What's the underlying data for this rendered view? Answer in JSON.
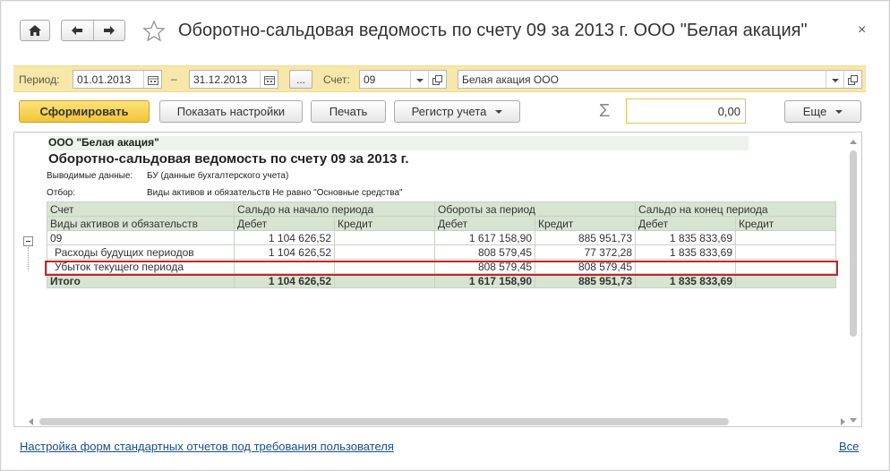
{
  "window": {
    "title": "Оборотно-сальдовая ведомость по счету 09 за 2013 г. ООО \"Белая акация\"",
    "close_symbol": "×",
    "icons": [
      "home-icon",
      "arrow-left-icon",
      "arrow-right-icon",
      "star-icon",
      "close-icon"
    ]
  },
  "period_bar": {
    "period_label": "Период:",
    "date_from": "01.01.2013",
    "dash": "–",
    "date_to": "31.12.2013",
    "ellipsis": "...",
    "account_label": "Счет:",
    "account_value": "09",
    "organization_value": "Белая акация ООО"
  },
  "toolbar": {
    "generate": "Сформировать",
    "show_settings": "Показать настройки",
    "print": "Печать",
    "register": "Регистр учета",
    "sigma": "Σ",
    "sum_value": "0,00",
    "more": "Еще"
  },
  "report": {
    "organization": "ООО \"Белая акация\"",
    "title": "Оборотно-сальдовая ведомость по счету 09 за 2013 г.",
    "output_label": "Выводимые данные:",
    "output_value": "БУ (данные бухгалтерского учета)",
    "filter_label": "Отбор:",
    "filter_value": "Виды активов и обязательств Не равно \"Основные средства\"",
    "headers": {
      "account": "Счет",
      "opening": "Сальдо на начало периода",
      "turnover": "Обороты за период",
      "closing": "Сальдо на конец периода",
      "subaccount": "Виды активов и обязательств",
      "debit": "Дебет",
      "credit": "Кредит"
    },
    "rows": [
      {
        "name": "09",
        "open_d": "1 104 626,52",
        "open_c": "",
        "turn_d": "1 617 158,90",
        "turn_c": "885 951,73",
        "close_d": "1 835 833,69",
        "close_c": ""
      },
      {
        "name": "Расходы будущих периодов",
        "open_d": "1 104 626,52",
        "open_c": "",
        "turn_d": "808 579,45",
        "turn_c": "77 372,28",
        "close_d": "1 835 833,69",
        "close_c": ""
      },
      {
        "name": "Убыток текущего периода",
        "open_d": "",
        "open_c": "",
        "turn_d": "808 579,45",
        "turn_c": "808 579,45",
        "close_d": "",
        "close_c": ""
      }
    ],
    "total": {
      "name": "Итого",
      "open_d": "1 104 626,52",
      "open_c": "",
      "turn_d": "1 617 158,90",
      "turn_c": "885 951,73",
      "close_d": "1 835 833,69",
      "close_c": ""
    }
  },
  "footer": {
    "settings_link": "Настройка форм стандартных отчетов под требования пользователя",
    "all_link": "Все"
  }
}
